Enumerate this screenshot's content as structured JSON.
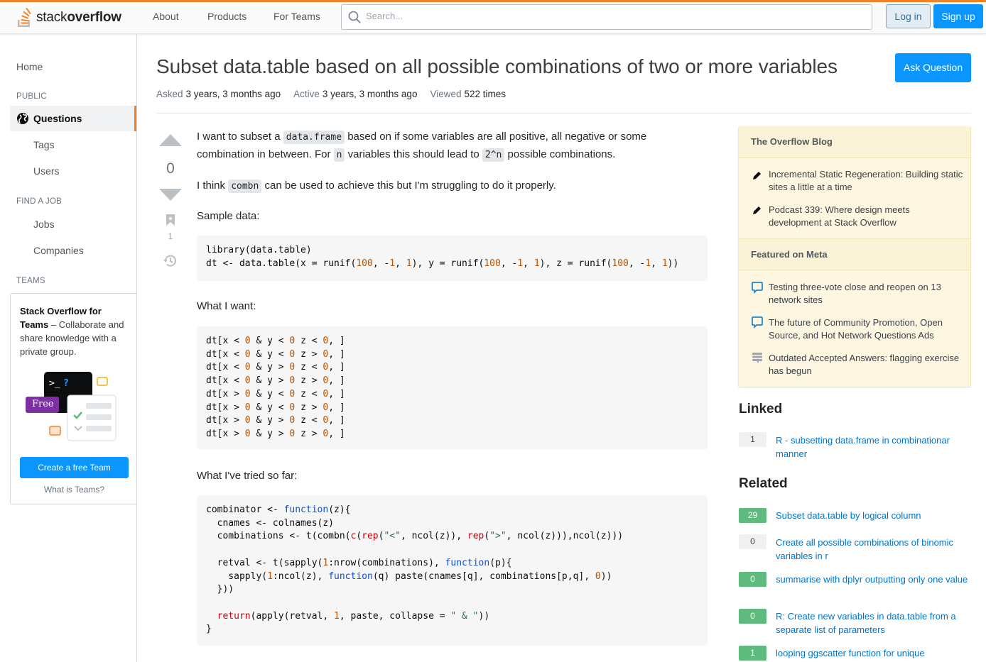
{
  "header": {
    "logo_text_light": "stack",
    "logo_text_bold": "overflow",
    "nav": [
      "About",
      "Products",
      "For Teams"
    ],
    "search_placeholder": "Search...",
    "login": "Log in",
    "signup": "Sign up"
  },
  "sidebar": {
    "home": "Home",
    "public_heading": "PUBLIC",
    "questions": "Questions",
    "tags": "Tags",
    "users": "Users",
    "find_job_heading": "FIND A JOB",
    "jobs": "Jobs",
    "companies": "Companies",
    "teams_heading": "TEAMS",
    "teams_promo_bold": "Stack Overflow for Teams",
    "teams_promo_rest": " – Collaborate and share knowledge with a private group.",
    "teams_free_badge": "Free",
    "create_team": "Create a free Team",
    "what_is_teams": "What is Teams?"
  },
  "question": {
    "title": "Subset data.table based on all possible combinations of two or more variables",
    "ask_button": "Ask Question",
    "asked_label": "Asked",
    "asked_value": "3 years, 3 months ago",
    "active_label": "Active",
    "active_value": "3 years, 3 months ago",
    "viewed_label": "Viewed",
    "viewed_value": "522 times",
    "score": "0",
    "bookmark_count": "1"
  },
  "body": {
    "p1a": "I want to subset a ",
    "p1_code1": "data.frame",
    "p1b": " based on if some variables are all positive, all negative or some",
    "p1c": "combination in between. For ",
    "p1_code2": "n",
    "p1d": " variables this should lead to ",
    "p1_code3": "2^n",
    "p1e": " possible combinations.",
    "p2a": "I think ",
    "p2_code": "combn",
    "p2b": " can be used to achieve this but I'm struggling to do it properly.",
    "sample_label": "Sample data:",
    "want_label": "What I want:",
    "tried_label": "What I've tried so far:",
    "want_rows": [
      "dt[x < 0 & y < 0 z < 0, ]",
      "dt[x < 0 & y < 0 z > 0, ]",
      "dt[x < 0 & y > 0 z < 0, ]",
      "dt[x < 0 & y > 0 z > 0, ]",
      "dt[x > 0 & y < 0 z < 0, ]",
      "dt[x > 0 & y < 0 z > 0, ]",
      "dt[x > 0 & y > 0 z < 0, ]",
      "dt[x > 0 & y > 0 z > 0, ]"
    ]
  },
  "blog": {
    "heading": "The Overflow Blog",
    "items": [
      "Incremental Static Regeneration: Building static sites a little at a time",
      "Podcast 339: Where design meets development at Stack Overflow"
    ],
    "meta_heading": "Featured on Meta",
    "meta_items": [
      "Testing three-vote close and reopen on 13 network sites",
      "The future of Community Promotion, Open Source, and Hot Network Questions Ads",
      "Outdated Accepted Answers: flagging exercise has begun"
    ]
  },
  "linked": {
    "heading": "Linked",
    "items": [
      {
        "count": "1",
        "title": "R - subsetting data.frame in combinationar manner"
      }
    ]
  },
  "related": {
    "heading": "Related",
    "items": [
      {
        "count": "29",
        "title": "Subset data.table by logical column"
      },
      {
        "count": "0",
        "title": "Create all possible combinations of binomic variables in r"
      },
      {
        "count": "0",
        "title": "summarise with dplyr outputting only one value"
      },
      {
        "count": "0",
        "title": "R: Create new variables in data.table from a separate list of parameters"
      },
      {
        "count": "1",
        "title": "looping ggscatter function for unique"
      }
    ]
  },
  "colors": {
    "accent": "#f48225",
    "primary": "#0a95ff",
    "answered": "#5eba7d"
  }
}
